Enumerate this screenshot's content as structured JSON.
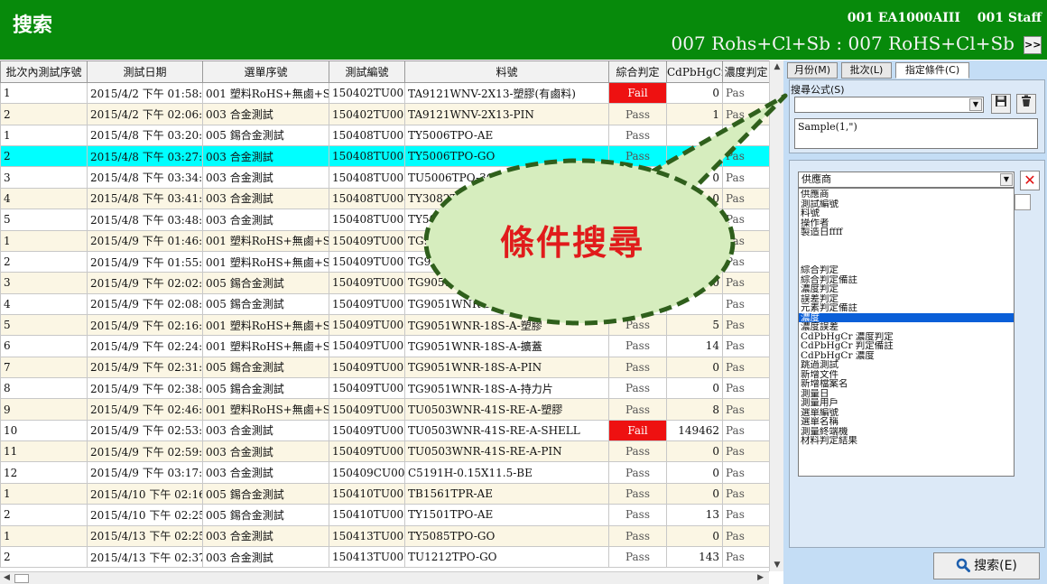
{
  "header": {
    "title": "搜索",
    "code": "001 EA1000AIII",
    "user": "001 Staff",
    "filter": "007 Rohs+Cl+Sb : 007 RoHS+Cl+Sb",
    "more_label": ">>"
  },
  "table": {
    "columns": [
      "批次內測試序號",
      "測試日期",
      "選單序號",
      "測試編號",
      "料號",
      "綜合判定",
      "CdPbHgCr",
      "濃度判定"
    ],
    "rows": [
      [
        "1",
        "2015/4/2 下午 01:58:32",
        "001 塑料RoHS+無鹵+Sb",
        "150402TU001",
        "TA9121WNV-2X13-塑膠(有鹵料)",
        "Fail",
        "0",
        "Pas"
      ],
      [
        "2",
        "2015/4/2 下午 02:06:45",
        "003 合金測試",
        "150402TU001",
        "TA9121WNV-2X13-PIN",
        "Pass",
        "1",
        "Pas"
      ],
      [
        "1",
        "2015/4/8 下午 03:20:23",
        "005 錫合金測試",
        "150408TU001",
        "TY5006TPO-AE",
        "Pass",
        "",
        "Pas"
      ],
      [
        "2",
        "2015/4/8 下午 03:27:10",
        "003 合金測試",
        "150408TU002",
        "TY5006TPO-GO",
        "Pass",
        "",
        "Pas"
      ],
      [
        "3",
        "2015/4/8 下午 03:34:51",
        "003 合金測試",
        "150408TU003",
        "TU5006TPO-3GO",
        "Pass",
        "0",
        "Pas"
      ],
      [
        "4",
        "2015/4/8 下午 03:41:38",
        "003 合金測試",
        "150408TU004",
        "TY3082TPO",
        "",
        "0",
        "Pas"
      ],
      [
        "5",
        "2015/4/8 下午 03:48:10",
        "003 合金測試",
        "150408TU005",
        "TY508",
        "",
        "0",
        "Pas"
      ],
      [
        "1",
        "2015/4/9 下午 01:46:48",
        "001 塑料RoHS+無鹵+Sb",
        "150409TU001",
        "TG9",
        "",
        "",
        "Pas"
      ],
      [
        "2",
        "2015/4/9 下午 01:55:15",
        "001 塑料RoHS+無鹵+Sb",
        "150409TU003",
        "TG9",
        "",
        "",
        "Pas"
      ],
      [
        "3",
        "2015/4/9 下午 02:02:04",
        "005 錫合金測試",
        "150409TU001",
        "TG9051",
        "",
        "0",
        "Pas"
      ],
      [
        "4",
        "2015/4/9 下午 02:08:18",
        "005 錫合金測試",
        "150409TU001",
        "TG9051WNR-1",
        "",
        "",
        "Pas"
      ],
      [
        "5",
        "2015/4/9 下午 02:16:33",
        "001 塑料RoHS+無鹵+Sb",
        "150409TU002",
        "TG9051WNR-18S-A-塑膠",
        "Pass",
        "5",
        "Pas"
      ],
      [
        "6",
        "2015/4/9 下午 02:24:21",
        "001 塑料RoHS+無鹵+Sb",
        "150409TU003",
        "TG9051WNR-18S-A-擴蓋",
        "Pass",
        "14",
        "Pas"
      ],
      [
        "7",
        "2015/4/9 下午 02:31:09",
        "005 錫合金測試",
        "150409TU002",
        "TG9051WNR-18S-A-PIN",
        "Pass",
        "0",
        "Pas"
      ],
      [
        "8",
        "2015/4/9 下午 02:38:07",
        "005 錫合金測試",
        "150409TU002",
        "TG9051WNR-18S-A-持力片",
        "Pass",
        "0",
        "Pas"
      ],
      [
        "9",
        "2015/4/9 下午 02:46:53",
        "001 塑料RoHS+無鹵+Sb",
        "150409TU003",
        "TU0503WNR-41S-RE-A-塑膠",
        "Pass",
        "8",
        "Pas"
      ],
      [
        "10",
        "2015/4/9 下午 02:53:12",
        "003 合金測試",
        "150409TU003",
        "TU0503WNR-41S-RE-A-SHELL",
        "Fail",
        "149462",
        "Pas"
      ],
      [
        "11",
        "2015/4/9 下午 02:59:40",
        "003 合金測試",
        "150409TU003",
        "TU0503WNR-41S-RE-A-PIN",
        "Pass",
        "0",
        "Pas"
      ],
      [
        "12",
        "2015/4/9 下午 03:17:58",
        "003 合金測試",
        "150409CU001",
        "C5191H-0.15X11.5-BE",
        "Pass",
        "0",
        "Pas"
      ],
      [
        "1",
        "2015/4/10 下午 02:16:19",
        "005 錫合金測試",
        "150410TU001",
        "TB1561TPR-AE",
        "Pass",
        "0",
        "Pas"
      ],
      [
        "2",
        "2015/4/10 下午 02:25:06",
        "005 錫合金測試",
        "150410TU002",
        "TY1501TPO-AE",
        "Pass",
        "13",
        "Pas"
      ],
      [
        "1",
        "2015/4/13 下午 02:25:38",
        "003 合金測試",
        "150413TU001",
        "TY5085TPO-GO",
        "Pass",
        "0",
        "Pas"
      ],
      [
        "2",
        "2015/4/13 下午 02:37:39",
        "003 合金測試",
        "150413TU002",
        "TU1212TPO-GO",
        "Pass",
        "143",
        "Pas"
      ]
    ],
    "selected_row": 3
  },
  "panel": {
    "tabs": [
      "月份(M)",
      "批次(L)",
      "指定條件(C)"
    ],
    "formula_label": "搜尋公式(S)",
    "formula_value": "",
    "formula_text": "Sample(1,\")",
    "condition_value": "供應商",
    "condition_options": [
      "供應商",
      "測試編號",
      "料號",
      "操作者",
      "製造日ffff",
      "",
      "",
      "",
      "綜合判定",
      "綜合判定備註",
      "濃度判定",
      "誤差判定",
      "元素判定備註",
      "濃度",
      "濃度誤差",
      "CdPbHgCr 濃度判定",
      "CdPbHgCr 判定備註",
      "CdPbHgCr 濃度",
      "跳過測試",
      "新增文件",
      "新增檔案名",
      "測量日",
      "測量用戶",
      "選單編號",
      "選單名稱",
      "測量終端機",
      "材料判定結果"
    ],
    "highlighted_option": 13,
    "search_label": "搜索(E)"
  },
  "callout": {
    "text": "條件搜尋"
  },
  "colors": {
    "header_bg": "#078a0b",
    "fail": "#ee1111",
    "selected_row": "#00ffff",
    "panel_bg": "#c4ddf5",
    "callout_fill": "#d6edbe",
    "callout_border": "#2f5f1c",
    "callout_text": "#e11b1b"
  }
}
